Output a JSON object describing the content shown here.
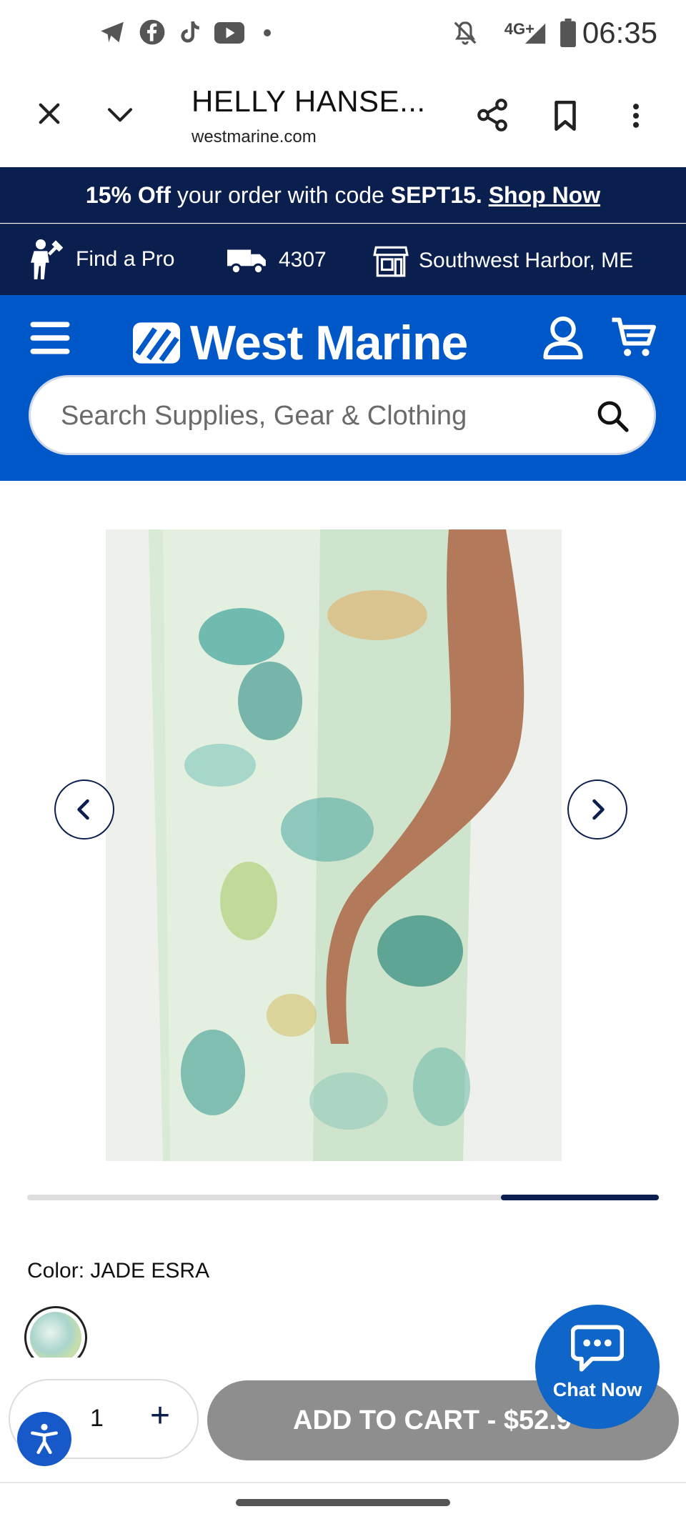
{
  "status_bar": {
    "time": "06:35",
    "network": "4G+",
    "icons": [
      "telegram-icon",
      "facebook-icon",
      "tiktok-icon",
      "youtube-icon",
      "dot-icon",
      "mute-icon",
      "signal-icon",
      "battery-icon"
    ]
  },
  "browser": {
    "page_title": "HELLY HANSE...",
    "url": "westmarine.com"
  },
  "promo": {
    "part1": "15% Off",
    "part2": " your order with code ",
    "code": "SEPT15.",
    "link": "Shop Now"
  },
  "utility": {
    "find_pro": "Find a Pro",
    "zip": "4307",
    "store": "Southwest Harbor, ME"
  },
  "header": {
    "logo_text": "West Marine",
    "search_placeholder": "Search Supplies, Gear & Clothing"
  },
  "gallery": {
    "progress_start": 0.75,
    "progress_end": 1.0
  },
  "product": {
    "color_label": "Color: JADE ESRA",
    "quantity": "1",
    "add_to_cart": "ADD TO CART - $52.9"
  },
  "chat": {
    "label": "Chat Now"
  },
  "colors": {
    "navy": "#0b1f4f",
    "brand_blue": "#0057c8",
    "chat_blue": "#1065c8",
    "cart_disabled": "#8e8e8e"
  }
}
